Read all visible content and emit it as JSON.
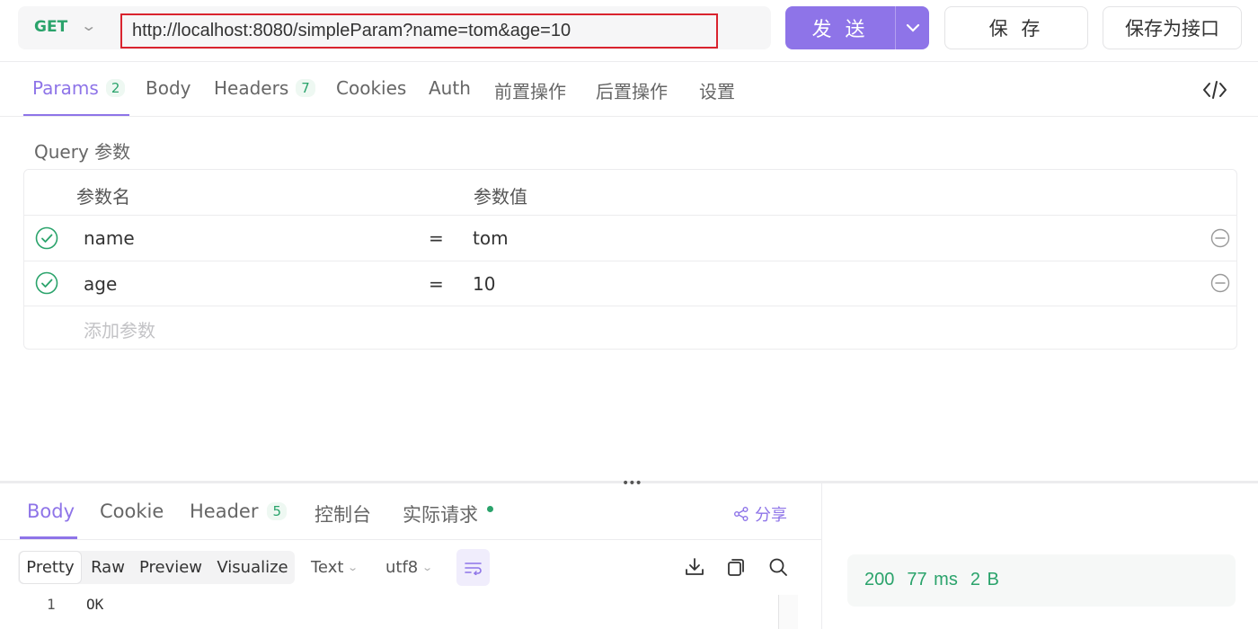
{
  "request": {
    "method": "GET",
    "url": "http://localhost:8080/simpleParam?name=tom&age=10",
    "send_label": "发 送",
    "save_label": "保 存",
    "save_as_label": "保存为接口"
  },
  "request_tabs": [
    {
      "label": "Params",
      "badge": "2",
      "active": true
    },
    {
      "label": "Body"
    },
    {
      "label": "Headers",
      "badge": "7"
    },
    {
      "label": "Cookies"
    },
    {
      "label": "Auth"
    },
    {
      "label": "前置操作"
    },
    {
      "label": "后置操作"
    },
    {
      "label": "设置"
    }
  ],
  "query": {
    "title": "Query 参数",
    "col_name": "参数名",
    "col_value": "参数值",
    "params": [
      {
        "name": "name",
        "eq": "=",
        "value": "tom",
        "enabled": true
      },
      {
        "name": "age",
        "eq": "=",
        "value": "10",
        "enabled": true
      }
    ],
    "add_placeholder": "添加参数"
  },
  "response_tabs": [
    {
      "label": "Body",
      "active": true
    },
    {
      "label": "Cookie"
    },
    {
      "label": "Header",
      "badge": "5"
    },
    {
      "label": "控制台"
    },
    {
      "label": "实际请求",
      "dot": true
    }
  ],
  "share_label": "分享",
  "view_modes": [
    "Pretty",
    "Raw",
    "Preview",
    "Visualize"
  ],
  "active_view_mode": "Pretty",
  "format_select": "Text",
  "encoding_select": "utf8",
  "body_lines": [
    {
      "no": "1",
      "text": "OK"
    }
  ],
  "status": {
    "code": "200",
    "time": "77 ms",
    "size": "2 B"
  },
  "colors": {
    "accent": "#8e74e8",
    "success": "#2aa36b",
    "url_highlight": "#d9232e"
  }
}
